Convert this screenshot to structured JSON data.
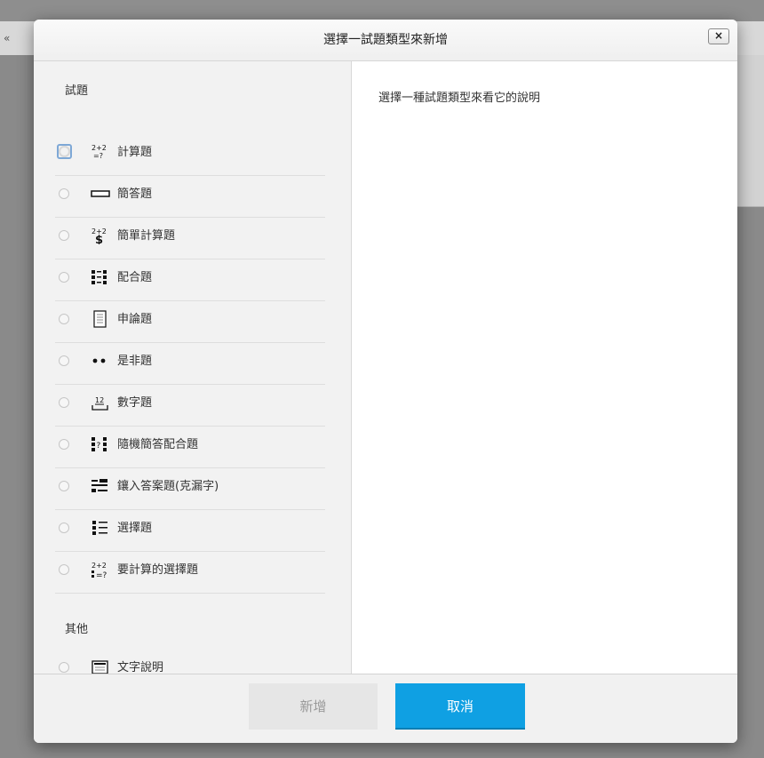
{
  "background": {
    "edge_glyph": "«"
  },
  "dialog": {
    "title": "選擇一試題類型來新增",
    "close_label": "×",
    "help_text": "選擇一種試題類型來看它的說明"
  },
  "question_section": {
    "label": "試題",
    "items": [
      {
        "label": "計算題",
        "icon": "calculated-icon"
      },
      {
        "label": "簡答題",
        "icon": "short-answer-icon"
      },
      {
        "label": "簡單計算題",
        "icon": "simple-calculated-icon"
      },
      {
        "label": "配合題",
        "icon": "matching-icon"
      },
      {
        "label": "申論題",
        "icon": "essay-icon"
      },
      {
        "label": "是非題",
        "icon": "true-false-icon"
      },
      {
        "label": "數字題",
        "icon": "numerical-icon"
      },
      {
        "label": "隨機簡答配合題",
        "icon": "random-short-answer-matching-icon"
      },
      {
        "label": "鑲入答案題(克漏字)",
        "icon": "embedded-answers-icon"
      },
      {
        "label": "選擇題",
        "icon": "multiple-choice-icon"
      },
      {
        "label": "要計算的選擇題",
        "icon": "calculated-multichoice-icon"
      }
    ]
  },
  "other_section": {
    "label": "其他",
    "items": [
      {
        "label": "文字說明",
        "icon": "description-icon"
      }
    ]
  },
  "footer": {
    "add_label": "新增",
    "cancel_label": "取消"
  },
  "colors": {
    "primary_button": "#0fa0e3",
    "disabled_button": "#e6e6e6",
    "focus_ring": "#7ea8d6"
  }
}
